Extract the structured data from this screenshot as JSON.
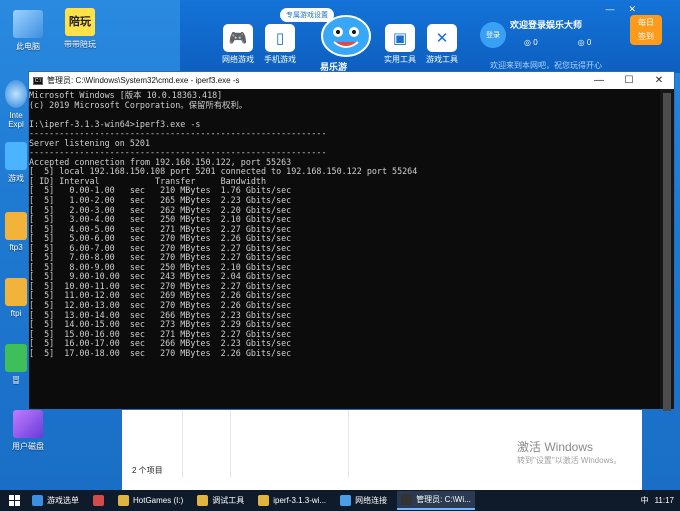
{
  "desktop": {
    "icons": [
      {
        "label": "此电脑"
      },
      {
        "label": "带带陪玩"
      },
      {
        "label": "Inte"
      },
      {
        "label": "Expl"
      },
      {
        "label": "游戏"
      },
      {
        "label": "ftp3"
      },
      {
        "label": "ftpi"
      },
      {
        "label": "冒"
      },
      {
        "label": "用户磁盘"
      }
    ],
    "pei_text": "陪玩"
  },
  "launcher": {
    "ribbon": "专属游戏设置",
    "tools": [
      {
        "label": "网络游戏",
        "icon": "gamepad-icon"
      },
      {
        "label": "手机游戏",
        "icon": "phone-icon"
      },
      {
        "label": "实用工具",
        "icon": "toolbox-icon"
      },
      {
        "label": "游戏工具",
        "icon": "swords-icon"
      }
    ],
    "brand": "易乐游",
    "login": "登录",
    "welcome": "欢迎登录娱乐大师",
    "coin1": "0",
    "coin2": "0",
    "news": "欢迎来到本网吧，祝您玩得开心",
    "signin_line1": "每日",
    "signin_line2": "签到",
    "min": "—",
    "close": "✕"
  },
  "cmd": {
    "title": "管理员: C:\\Windows\\System32\\cmd.exe - iperf3.exe  -s",
    "minimize": "—",
    "maximize": "☐",
    "close": "✕",
    "icon_text": "C:\\",
    "lines": [
      "Microsoft Windows [版本 10.0.18363.418]",
      "(c) 2019 Microsoft Corporation。保留所有权利。",
      "",
      "I:\\iperf-3.1.3-win64>iperf3.exe -s",
      "-----------------------------------------------------------",
      "Server listening on 5201",
      "-----------------------------------------------------------",
      "Accepted connection from 192.168.150.122, port 55263",
      "[  5] local 192.168.150.108 port 5201 connected to 192.168.150.122 port 55264",
      "[ ID] Interval           Transfer     Bandwidth",
      "[  5]   0.00-1.00   sec   210 MBytes  1.76 Gbits/sec",
      "[  5]   1.00-2.00   sec   265 MBytes  2.23 Gbits/sec",
      "[  5]   2.00-3.00   sec   262 MBytes  2.20 Gbits/sec",
      "[  5]   3.00-4.00   sec   250 MBytes  2.10 Gbits/sec",
      "[  5]   4.00-5.00   sec   271 MBytes  2.27 Gbits/sec",
      "[  5]   5.00-6.00   sec   270 MBytes  2.26 Gbits/sec",
      "[  5]   6.00-7.00   sec   270 MBytes  2.27 Gbits/sec",
      "[  5]   7.00-8.00   sec   270 MBytes  2.27 Gbits/sec",
      "[  5]   8.00-9.00   sec   250 MBytes  2.10 Gbits/sec",
      "[  5]   9.00-10.00  sec   243 MBytes  2.04 Gbits/sec",
      "[  5]  10.00-11.00  sec   270 MBytes  2.27 Gbits/sec",
      "[  5]  11.00-12.00  sec   269 MBytes  2.26 Gbits/sec",
      "[  5]  12.00-13.00  sec   270 MBytes  2.26 Gbits/sec",
      "[  5]  13.00-14.00  sec   266 MBytes  2.23 Gbits/sec",
      "[  5]  14.00-15.00  sec   273 MBytes  2.29 Gbits/sec",
      "[  5]  15.00-16.00  sec   271 MBytes  2.27 Gbits/sec",
      "[  5]  16.00-17.00  sec   266 MBytes  2.23 Gbits/sec",
      "[  5]  17.00-18.00  sec   270 MBytes  2.26 Gbits/sec"
    ]
  },
  "explorer": {
    "status": "2 个项目"
  },
  "watermark": {
    "line1": "激活 Windows",
    "line2": "转到\"设置\"以激活 Windows。"
  },
  "taskbar": {
    "items": [
      {
        "label": "游戏选单",
        "color": "#3b8fe0"
      },
      {
        "label": "",
        "color": "#d34c4c"
      },
      {
        "label": "HotGames (I:)",
        "color": "#e0b440"
      },
      {
        "label": "调试工具",
        "color": "#e0b440"
      },
      {
        "label": "iperf-3.1.3-wi...",
        "color": "#e0b440"
      },
      {
        "label": "网络连接",
        "color": "#4aa0e8"
      },
      {
        "label": "管理员: C:\\Wi...",
        "color": "#333333"
      }
    ],
    "lang": "中",
    "clock": "11:17"
  }
}
